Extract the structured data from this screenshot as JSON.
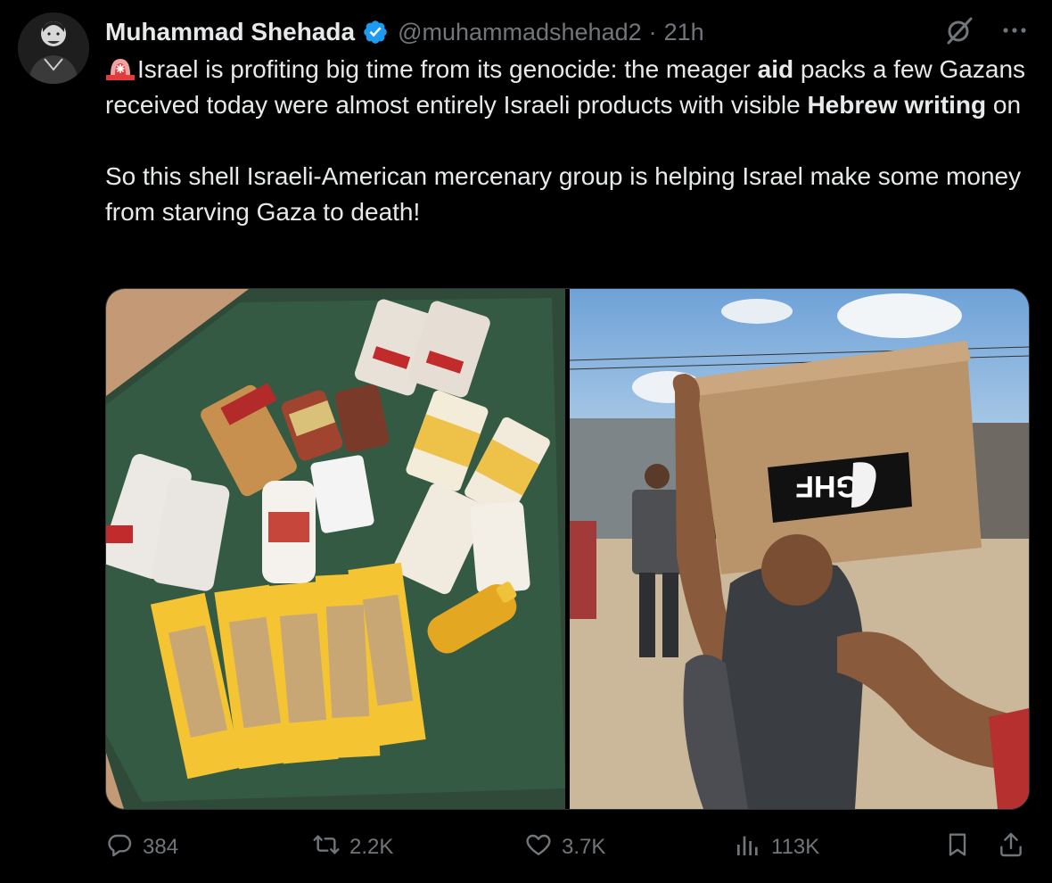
{
  "tweet": {
    "author": {
      "display_name": "Muhammad Shehada",
      "verified": true,
      "handle": "@muhammadshehad2",
      "separator": "·",
      "time": "21h"
    },
    "text": {
      "line1_pre": "Israel is profiting big time from its genocide: the meager ",
      "line1_bold": "aid",
      "line1_post": " packs a few Gazans received today were almost entirely Israeli products with visible ",
      "line1_bold2": "Hebrew writing",
      "line1_post2": " on",
      "line2": "So this shell Israeli-American mercenary group is helping Israel make some money from starving Gaza to death!"
    },
    "media": {
      "box_logo_text": "GHF"
    },
    "actions": {
      "replies": "384",
      "reposts": "2.2K",
      "likes": "3.7K",
      "views": "113K"
    },
    "icons": [
      "siren-emoji-icon",
      "verified-badge-icon",
      "grok-icon",
      "more-icon",
      "reply-icon",
      "repost-icon",
      "like-icon",
      "views-icon",
      "bookmark-icon",
      "share-icon"
    ],
    "colors": {
      "background": "#000000",
      "text": "#e7e9ea",
      "secondary": "#71767b",
      "verified": "#1d9bf0"
    }
  }
}
